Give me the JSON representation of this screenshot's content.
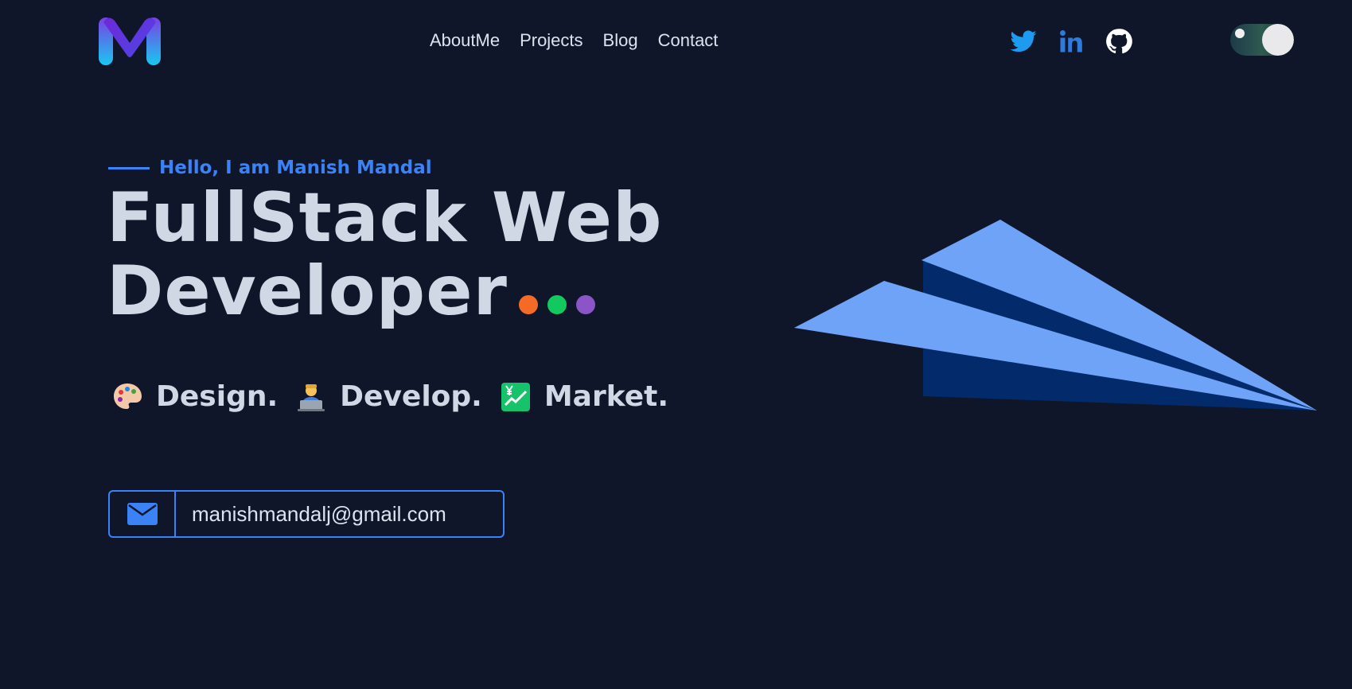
{
  "header": {
    "logo_icon": "m-logo-icon",
    "nav": [
      {
        "label": "AboutMe"
      },
      {
        "label": "Projects"
      },
      {
        "label": "Blog"
      },
      {
        "label": "Contact"
      }
    ],
    "social": [
      {
        "icon": "twitter-icon",
        "color": "#1d9bf0"
      },
      {
        "icon": "linkedin-icon",
        "color": "#2f7bdc"
      },
      {
        "icon": "github-icon",
        "color": "#ffffff"
      }
    ],
    "theme_toggle": {
      "icon": "theme-toggle"
    }
  },
  "hero": {
    "greeting": "Hello, I am Manish Mandal",
    "headline_line1": "FullStack Web",
    "headline_line2": "Developer",
    "dot_colors": [
      "#f56a24",
      "#12c95d",
      "#8b55c7"
    ],
    "taglines": [
      {
        "icon": "palette-icon",
        "text": "Design."
      },
      {
        "icon": "developer-icon",
        "text": "Develop."
      },
      {
        "icon": "chart-icon",
        "text": "Market."
      }
    ],
    "email": "manishmandalj@gmail.com",
    "email_icon": "envelope-icon"
  },
  "colors": {
    "background": "#0f1629",
    "accent": "#3b82f6",
    "plane_light": "#6fa3f8",
    "plane_dark": "#032b6b"
  }
}
